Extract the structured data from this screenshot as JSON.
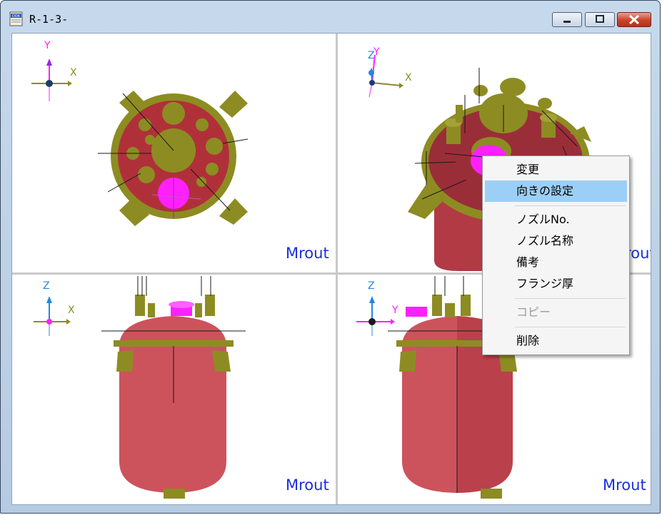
{
  "window": {
    "title": "R-1-3-",
    "app_icon": "dok-document-icon"
  },
  "title_buttons": {
    "minimize": "minimize-icon",
    "maximize": "maximize-icon",
    "close": "close-icon"
  },
  "viewports": [
    {
      "id": "top",
      "axes": [
        "Y",
        "X"
      ],
      "watermark": "Mrout"
    },
    {
      "id": "iso",
      "axes": [
        "Z",
        "Y",
        "X"
      ],
      "watermark": "Mrout"
    },
    {
      "id": "front",
      "axes": [
        "Z",
        "X"
      ],
      "watermark": "Mrout"
    },
    {
      "id": "side",
      "axes": [
        "Z",
        "Y"
      ],
      "watermark": "Mrout"
    }
  ],
  "context_menu": {
    "items": [
      {
        "label": "変更",
        "state": "normal"
      },
      {
        "label": "向きの設定",
        "state": "highlighted"
      },
      {
        "label": "ノズルNo.",
        "state": "normal"
      },
      {
        "label": "ノズル名称",
        "state": "normal"
      },
      {
        "label": "備考",
        "state": "normal"
      },
      {
        "label": "フランジ厚",
        "state": "normal"
      },
      {
        "label": "コピー",
        "state": "disabled"
      },
      {
        "label": "削除",
        "state": "normal"
      }
    ]
  },
  "colors": {
    "vessel_red": "#b0303a",
    "nozzle_olive": "#8d8c22",
    "magenta": "#ff20ff",
    "watermark_blue": "#1a2de0",
    "menu_highlight": "#9ccff5"
  }
}
